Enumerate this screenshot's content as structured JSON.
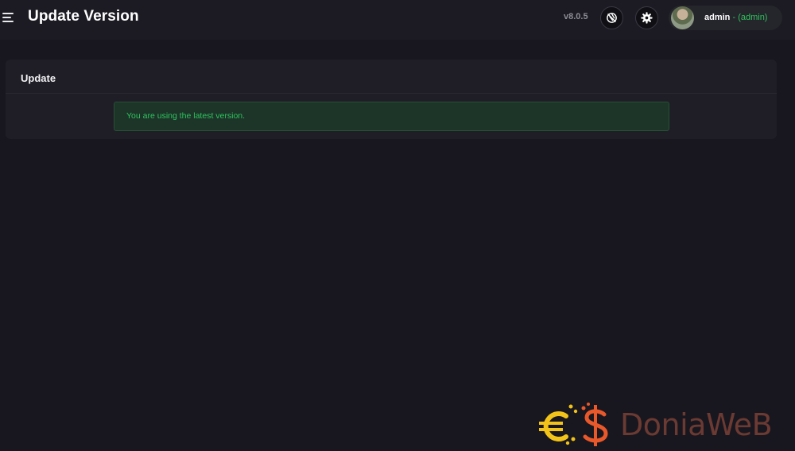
{
  "header": {
    "title": "Update Version",
    "version": "v8.0.5",
    "user": {
      "name": "admin",
      "role": "- (admin)"
    }
  },
  "icons": {
    "menu": "menu-icon",
    "theme": "palette-off-icon",
    "settings": "gear-icon"
  },
  "card": {
    "title": "Update",
    "alert_message": "You are using the latest version."
  },
  "watermark": {
    "text": "DoniaWeB"
  },
  "colors": {
    "background": "#18171f",
    "topbar": "#1c1b23",
    "card": "#1f1e26",
    "success_text": "#2fc35e",
    "success_bg": "#1d3529"
  }
}
